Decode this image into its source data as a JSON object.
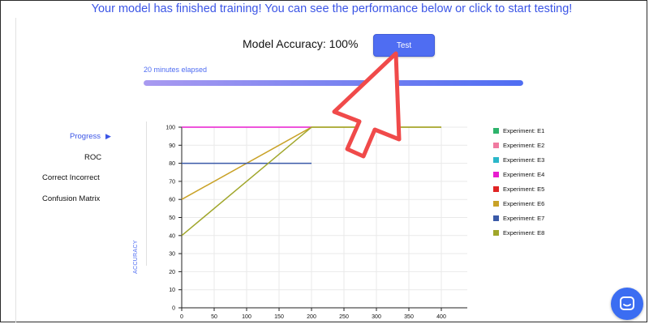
{
  "header": {
    "headline": "Your model has finished training! You can see the performance below or click to start testing!",
    "accuracy_text": "Model Accuracy: 100%",
    "test_label": "Test"
  },
  "progress": {
    "elapsed_text": "20 minutes elapsed",
    "fraction": 1.0
  },
  "nav": {
    "items": [
      {
        "label": "Progress",
        "active": true
      },
      {
        "label": "ROC"
      },
      {
        "label": "Correct Incorrect"
      },
      {
        "label": "Confusion Matrix"
      }
    ]
  },
  "chart_data": {
    "type": "line",
    "ylabel": "ACCURACY",
    "xlabel": "",
    "xlim": [
      0,
      440
    ],
    "ylim": [
      0,
      100
    ],
    "x_ticks": [
      0,
      50,
      100,
      150,
      200,
      250,
      300,
      350,
      400
    ],
    "y_ticks": [
      0,
      10,
      20,
      30,
      40,
      50,
      60,
      70,
      80,
      90,
      100
    ],
    "grid": true,
    "legend_position": "right",
    "series": [
      {
        "name": "Experiment: E1",
        "color": "#2db36b",
        "points": []
      },
      {
        "name": "Experiment: E2",
        "color": "#f07aa0",
        "points": []
      },
      {
        "name": "Experiment: E3",
        "color": "#2ab7c9",
        "points": []
      },
      {
        "name": "Experiment: E4",
        "color": "#e81ccf",
        "points": [
          [
            0,
            100
          ],
          [
            200,
            100
          ]
        ]
      },
      {
        "name": "Experiment: E5",
        "color": "#e02424",
        "points": []
      },
      {
        "name": "Experiment: E6",
        "color": "#c9a227",
        "points": [
          [
            0,
            60
          ],
          [
            200,
            100
          ],
          [
            400,
            100
          ]
        ]
      },
      {
        "name": "Experiment: E7",
        "color": "#3a5aa8",
        "points": [
          [
            0,
            80
          ],
          [
            200,
            80
          ]
        ]
      },
      {
        "name": "Experiment: E8",
        "color": "#a0a62a",
        "points": [
          [
            0,
            40
          ],
          [
            200,
            100
          ],
          [
            400,
            100
          ]
        ]
      }
    ]
  },
  "colors": {
    "accent": "#4f6df2",
    "annotation_arrow": "#f04a4a"
  },
  "icons": {
    "chat": "chat-bubble-icon",
    "nav_indicator": "triangle-right-icon",
    "annotation": "pointer-arrow-icon"
  }
}
